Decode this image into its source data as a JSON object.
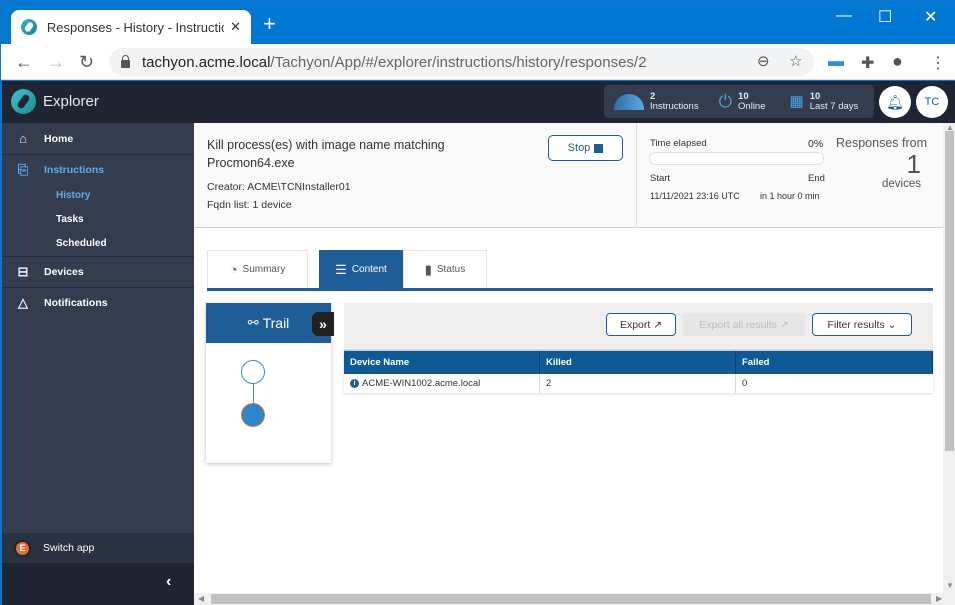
{
  "browser": {
    "tab_title": "Responses - History - Instructions",
    "new_tab_label": "+",
    "url_host": "tachyon.acme.local",
    "url_path": "/Tachyon/App/#/explorer/instructions/history/responses/2",
    "window_controls": {
      "minimize": "—",
      "maximize": "☐",
      "close": "✕"
    }
  },
  "app": {
    "name": "Explorer",
    "stats": {
      "instructions": {
        "value": "2",
        "label": "Instructions"
      },
      "online": {
        "value": "10",
        "label": "Online"
      },
      "last7": {
        "value": "10",
        "label": "Last 7 days"
      }
    },
    "user_initials": "TC"
  },
  "sidebar": {
    "items": [
      {
        "label": "Home",
        "icon": "home-icon"
      },
      {
        "label": "Instructions",
        "icon": "instructions-icon",
        "active": true
      },
      {
        "label": "Devices",
        "icon": "devices-icon"
      },
      {
        "label": "Notifications",
        "icon": "bell-icon"
      }
    ],
    "subitems": [
      {
        "label": "History",
        "active": true
      },
      {
        "label": "Tasks"
      },
      {
        "label": "Scheduled"
      }
    ],
    "switch_app": "Switch app",
    "collapse_icon": "‹"
  },
  "instruction": {
    "title_line1": "Kill process(es) with image name matching",
    "title_line2": "Procmon64.exe",
    "creator_label": "Creator:",
    "creator_value": "ACME\\TCNInstaller01",
    "fqdn_label": "Fqdn list:",
    "fqdn_value": "1 device",
    "stop_label": "Stop",
    "time_elapsed_label": "Time elapsed",
    "time_elapsed_percent": "0%",
    "progress": 0,
    "start_label": "Start",
    "end_label": "End",
    "start_value": "11/11/2021 23:16 UTC",
    "end_value": "in 1 hour 0 min",
    "responses_from": "Responses from",
    "responses_count": "1",
    "responses_unit": "devices"
  },
  "tabs": [
    {
      "label": "Summary",
      "active": false
    },
    {
      "label": "Content",
      "active": true
    },
    {
      "label": "Status",
      "active": false
    }
  ],
  "trail": {
    "title": "Trail",
    "expand_icon": "»"
  },
  "results": {
    "export_label": "Export",
    "export_all_label": "Export all results",
    "filter_label": "Filter results",
    "columns": [
      "Device Name",
      "Killed",
      "Failed"
    ],
    "rows": [
      {
        "device": "ACME-WIN1002.acme.local",
        "killed": "2",
        "failed": "0"
      }
    ]
  }
}
